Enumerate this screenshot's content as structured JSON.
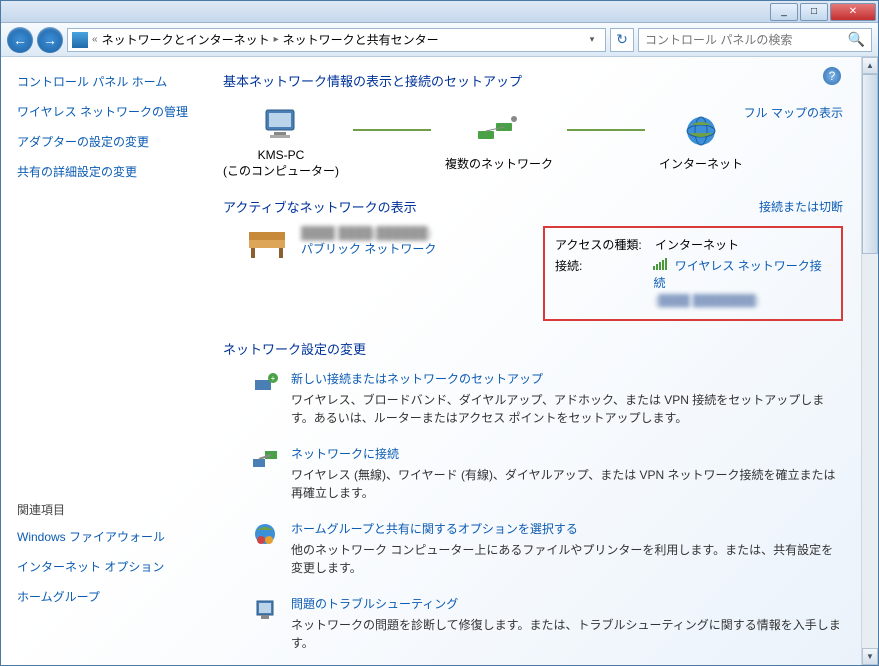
{
  "titlebar": {
    "min": "_",
    "max": "□",
    "close": "✕"
  },
  "nav": {
    "back": "←",
    "forward": "→",
    "refresh": "↻"
  },
  "breadcrumb": {
    "prefix": "«",
    "parent": "ネットワークとインターネット",
    "current": "ネットワークと共有センター",
    "arrow": "▸"
  },
  "search": {
    "placeholder": "コントロール パネルの検索"
  },
  "sidebar": {
    "home": "コントロール パネル ホーム",
    "wireless": "ワイヤレス ネットワークの管理",
    "adapter": "アダプターの設定の変更",
    "sharing": "共有の詳細設定の変更",
    "related_header": "関連項目",
    "firewall": "Windows ファイアウォール",
    "inetopt": "インターネット オプション",
    "homegroup": "ホームグループ"
  },
  "main": {
    "help": "?",
    "heading1": "基本ネットワーク情報の表示と接続のセットアップ",
    "full_map": "フル マップの表示",
    "map": {
      "node1_name": "KMS-PC",
      "node1_sub": "(このコンピューター)",
      "node2_name": "複数のネットワーク",
      "node3_name": "インターネット"
    },
    "heading2": "アクティブなネットワークの表示",
    "connect_disconnect": "接続または切断",
    "active": {
      "public_network": "パブリック ネットワーク",
      "access_label": "アクセスの種類:",
      "access_value": "インターネット",
      "conn_label": "接続:",
      "conn_value": "ワイヤレス ネットワーク接続"
    },
    "heading3": "ネットワーク設定の変更",
    "settings": [
      {
        "title": "新しい接続またはネットワークのセットアップ",
        "desc": "ワイヤレス、ブロードバンド、ダイヤルアップ、アドホック、または VPN 接続をセットアップします。あるいは、ルーターまたはアクセス ポイントをセットアップします。"
      },
      {
        "title": "ネットワークに接続",
        "desc": "ワイヤレス (無線)、ワイヤード (有線)、ダイヤルアップ、または VPN ネットワーク接続を確立または再確立します。"
      },
      {
        "title": "ホームグループと共有に関するオプションを選択する",
        "desc": "他のネットワーク コンピューター上にあるファイルやプリンターを利用します。または、共有設定を変更します。"
      },
      {
        "title": "問題のトラブルシューティング",
        "desc": "ネットワークの問題を診断して修復します。または、トラブルシューティングに関する情報を入手します。"
      }
    ]
  }
}
